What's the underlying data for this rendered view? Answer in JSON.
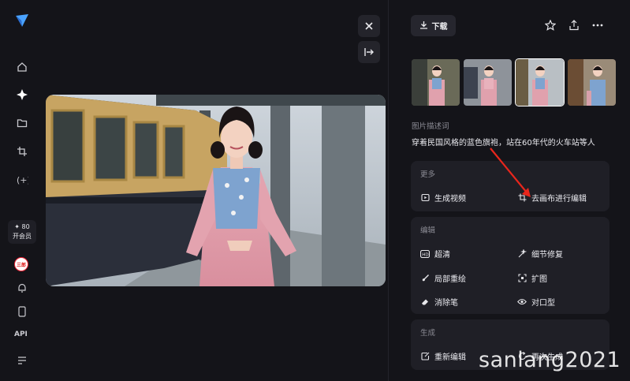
{
  "sidebar": {
    "items": [
      {
        "name": "home-icon"
      },
      {
        "name": "sparkle-icon"
      },
      {
        "name": "folder-icon"
      },
      {
        "name": "crop-icon"
      },
      {
        "name": "code-brace-icon"
      }
    ],
    "vip": {
      "count": "80",
      "label": "开会员"
    },
    "avatar_text": "三郎",
    "api_label": "API"
  },
  "viewer": {
    "close_icon": "close-icon",
    "share_icon": "export-arrow-icon"
  },
  "panel": {
    "download_label": "下载",
    "thumbnails_selected_index": 2,
    "prompt_section_label": "图片描述词",
    "prompt_text": "穿着民国风格的蓝色旗袍，站在60年代的火车站等人",
    "more": {
      "title": "更多",
      "items": [
        {
          "label": "生成视频",
          "icon": "video-icon"
        },
        {
          "label": "去画布进行编辑",
          "icon": "canvas-icon"
        }
      ]
    },
    "edit": {
      "title": "编辑",
      "items": [
        {
          "label": "超清",
          "icon": "hd-icon"
        },
        {
          "label": "细节修复",
          "icon": "magic-wand-icon"
        },
        {
          "label": "局部重绘",
          "icon": "brush-icon"
        },
        {
          "label": "扩图",
          "icon": "expand-icon"
        },
        {
          "label": "消除笔",
          "icon": "eraser-icon"
        },
        {
          "label": "对口型",
          "icon": "eye-icon"
        }
      ]
    },
    "generate": {
      "title": "生成",
      "items": [
        {
          "label": "重新编辑",
          "icon": "re-edit-icon"
        },
        {
          "label": "再次生成",
          "icon": "regenerate-icon"
        }
      ]
    }
  },
  "watermark": "sanlang2021",
  "colors": {
    "background": "#141419",
    "card": "#1f1f26",
    "arrow": "#e8261c"
  }
}
